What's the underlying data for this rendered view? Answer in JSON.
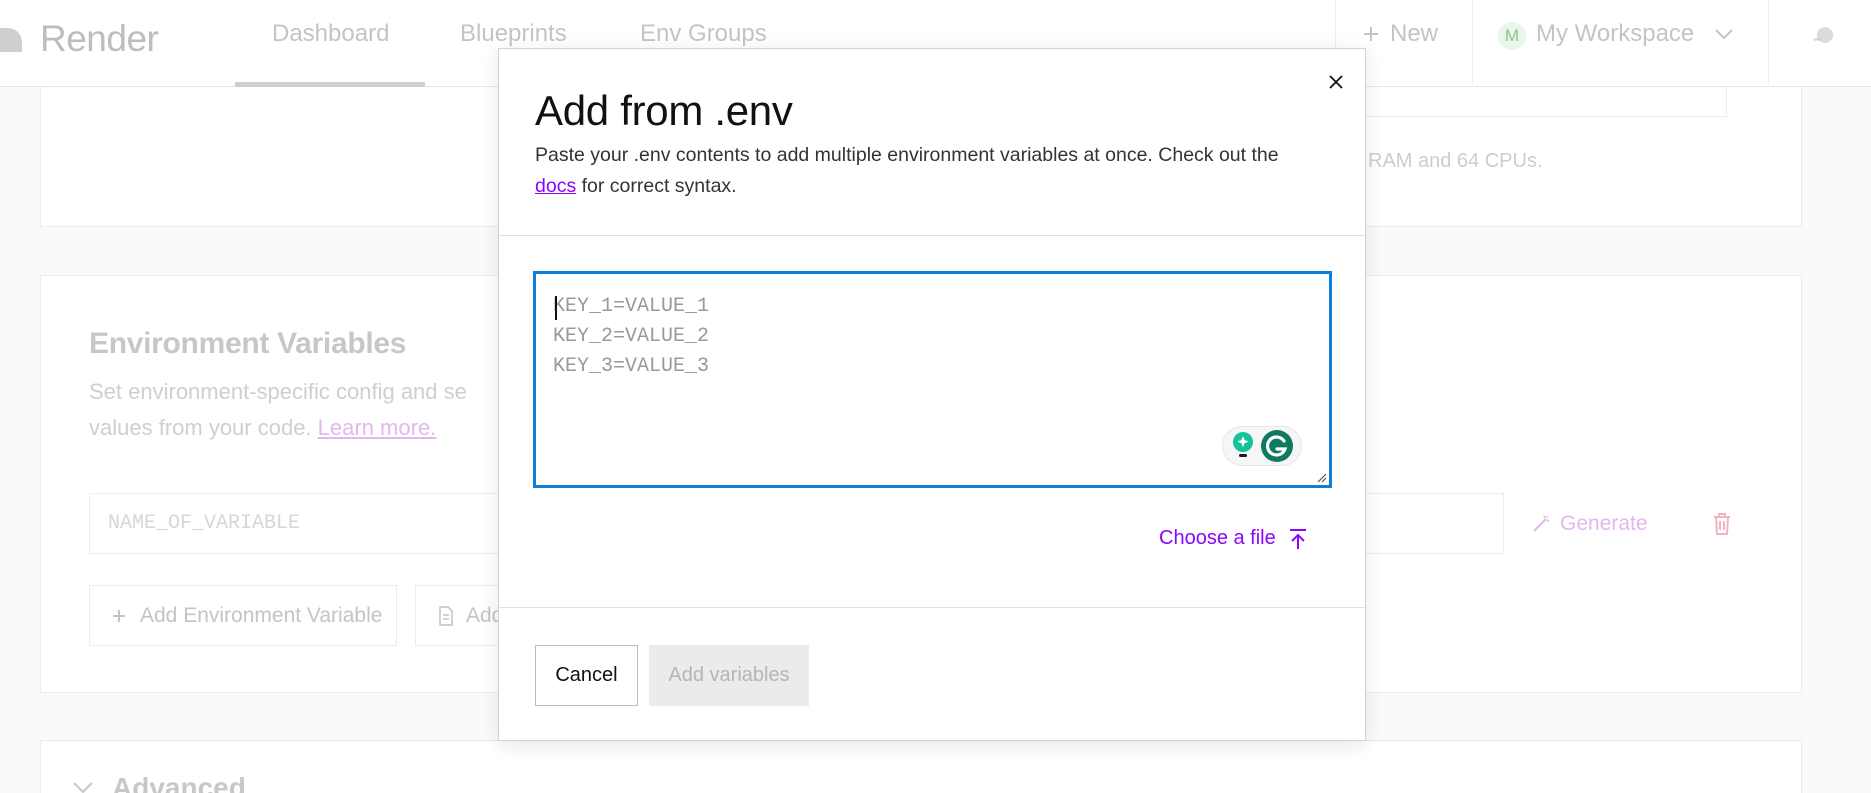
{
  "nav": {
    "brand": "Render",
    "tabs": [
      "Dashboard",
      "Blueprints",
      "Env Groups"
    ],
    "new_label": "New",
    "workspace_initial": "M",
    "workspace_name": "My Workspace"
  },
  "background": {
    "ram_text": "RAM and 64 CPUs.",
    "env_title": "Environment Variables",
    "env_desc_line1": "Set environment-specific config and se",
    "env_desc_line2": "values from your code.",
    "learn_more": "Learn more.",
    "var_name_placeholder": "NAME_OF_VARIABLE",
    "generate_label": "Generate",
    "add_env_var_label": "Add Environment Variable",
    "add_from_env_label": "Add",
    "advanced_label": "Advanced"
  },
  "modal": {
    "title": "Add from .env",
    "desc_prefix": "Paste your .env contents to add multiple environment variables at once. Check out the",
    "docs_link": "docs",
    "desc_suffix": "for correct syntax.",
    "placeholder_lines": [
      "KEY_1=VALUE_1",
      "KEY_2=VALUE_2",
      "KEY_3=VALUE_3"
    ],
    "choose_file_label": "Choose a file",
    "cancel_label": "Cancel",
    "add_variables_label": "Add variables"
  },
  "colors": {
    "accent_purple": "#8a05ff",
    "focus_blue": "#0c80d8",
    "grammarly_green": "#15c39a"
  },
  "icons": [
    "close-icon",
    "upload-icon",
    "plus-icon",
    "file-icon",
    "wand-icon",
    "trash-icon",
    "chevron-down-icon",
    "grammarly-icon"
  ]
}
